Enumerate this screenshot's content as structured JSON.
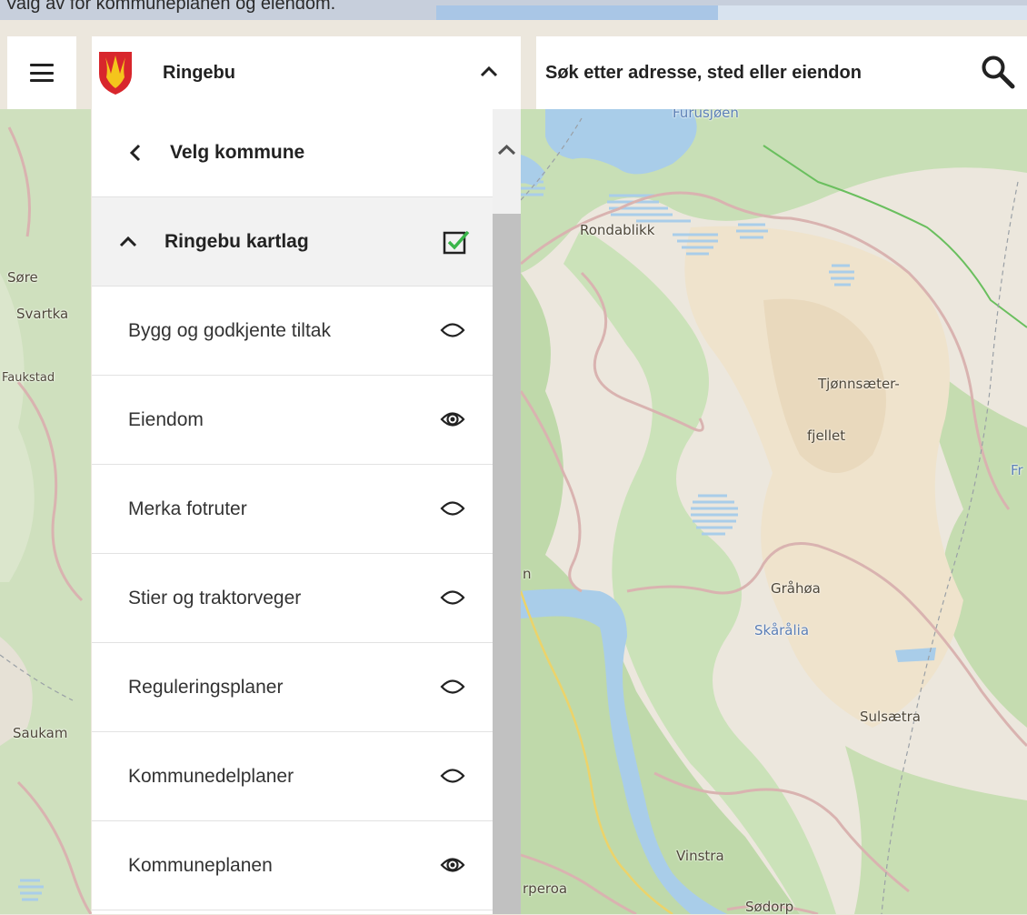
{
  "caption": "Valg av for kommuneplanen og eiendom.",
  "header": {
    "municipality": "Ringebu"
  },
  "search": {
    "placeholder": "Søk etter adresse, sted eller eiendon"
  },
  "panel": {
    "back_label": "Velg kommune",
    "group_label": "Ringebu kartlag",
    "group_checked": true,
    "layers": [
      {
        "label": "Bygg og godkjente tiltak",
        "visible": false
      },
      {
        "label": "Eiendom",
        "visible": true
      },
      {
        "label": "Merka fotruter",
        "visible": false
      },
      {
        "label": "Stier og traktorveger",
        "visible": false
      },
      {
        "label": "Reguleringsplaner",
        "visible": false
      },
      {
        "label": "Kommunedelplaner",
        "visible": false
      },
      {
        "label": "Kommuneplanen",
        "visible": true
      }
    ]
  },
  "map_labels": {
    "furusjoen": "Furusjøen",
    "rondablikk": "Rondablikk",
    "sore": "Søre",
    "svartka": "Svartka",
    "faukstad": "Faukstad",
    "tjonn1": "Tjønnsæter-",
    "tjonn2": "fjellet",
    "fr": "Fr",
    "grahoa": "Gråhøa",
    "skaralia": "Skårålia",
    "sulsaetra": "Sulsætra",
    "saukam": "Saukam",
    "vinstra": "Vinstra",
    "rperoa": "rperoa",
    "sodorp": "Sødorp",
    "n": "n"
  },
  "colors": {
    "accent_check": "#3ab54a",
    "map_green": "#c4ddb2",
    "map_land": "#ece7dd",
    "water": "#a9cde9",
    "road": "#d9b3b0"
  }
}
